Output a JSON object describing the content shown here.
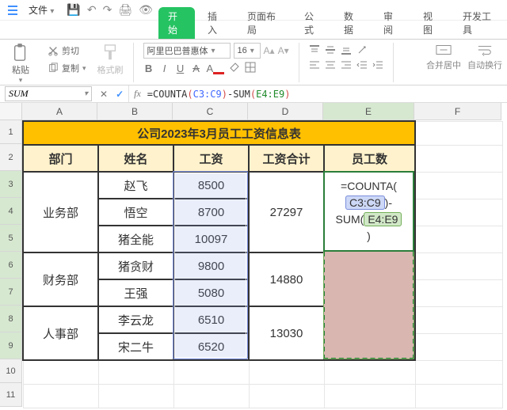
{
  "titlebar": {
    "file_label": "文件",
    "qat": {
      "save": "💾",
      "undo": "↶",
      "redo": "↷",
      "print": "🖨",
      "preview": "👁"
    }
  },
  "tabs": {
    "start": "开始",
    "insert": "插入",
    "layout": "页面布局",
    "formula": "公式",
    "data": "数据",
    "review": "审阅",
    "view": "视图",
    "dev": "开发工具"
  },
  "ribbon": {
    "paste": "粘贴",
    "cut": "剪切",
    "copy": "复制",
    "fmtpaint": "格式刷",
    "font_name": "阿里巴巴普惠体",
    "font_size": "16",
    "merge": "合并居中",
    "wrap": "自动换行"
  },
  "namebox": "SUM",
  "formula_bar": {
    "prefix": "=COUNTA",
    "open": "(",
    "r1": "C3:C9",
    "close": ")",
    "minus": "-SUM",
    "open2": "(",
    "r2": "E4:E9",
    "close2": ")"
  },
  "columns": {
    "A": "A",
    "B": "B",
    "C": "C",
    "D": "D",
    "E": "E",
    "F": "F"
  },
  "rows": [
    "1",
    "2",
    "3",
    "4",
    "5",
    "6",
    "7",
    "8",
    "9",
    "10",
    "11"
  ],
  "title": "公司2023年3月员工工资信息表",
  "headers": {
    "dept": "部门",
    "name": "姓名",
    "salary": "工资",
    "salary_sum": "工资合计",
    "emp_count": "员工数"
  },
  "depts": [
    {
      "dept": "业务部",
      "rows": [
        {
          "name": "赵飞",
          "salary": "8500"
        },
        {
          "name": "悟空",
          "salary": "8700"
        },
        {
          "name": "猪全能",
          "salary": "10097"
        }
      ],
      "sum": "27297"
    },
    {
      "dept": "财务部",
      "rows": [
        {
          "name": "猪贪财",
          "salary": "9800"
        },
        {
          "name": "王强",
          "salary": "5080"
        }
      ],
      "sum": "14880"
    },
    {
      "dept": "人事部",
      "rows": [
        {
          "name": "李云龙",
          "salary": "6510"
        },
        {
          "name": "宋二牛",
          "salary": "6520"
        }
      ],
      "sum": "13030"
    }
  ],
  "e_formula": {
    "p1": "=COUNTA(",
    "r1": "C3:C9",
    "p2": ")-",
    "p3": "SUM(",
    "r2": "E4:E9",
    "p4": ")"
  },
  "chart_data": {
    "type": "table",
    "title": "公司2023年3月员工工资信息表",
    "columns": [
      "部门",
      "姓名",
      "工资",
      "工资合计",
      "员工数"
    ],
    "rows": [
      [
        "业务部",
        "赵飞",
        8500,
        27297,
        null
      ],
      [
        "业务部",
        "悟空",
        8700,
        27297,
        null
      ],
      [
        "业务部",
        "猪全能",
        10097,
        27297,
        null
      ],
      [
        "财务部",
        "猪贪财",
        9800,
        14880,
        null
      ],
      [
        "财务部",
        "王强",
        5080,
        14880,
        null
      ],
      [
        "人事部",
        "李云龙",
        6510,
        13030,
        null
      ],
      [
        "人事部",
        "宋二牛",
        6520,
        13030,
        null
      ]
    ],
    "notes": "E3 contains formula =COUNTA(C3:C9)-SUM(E4:E9) being edited"
  }
}
